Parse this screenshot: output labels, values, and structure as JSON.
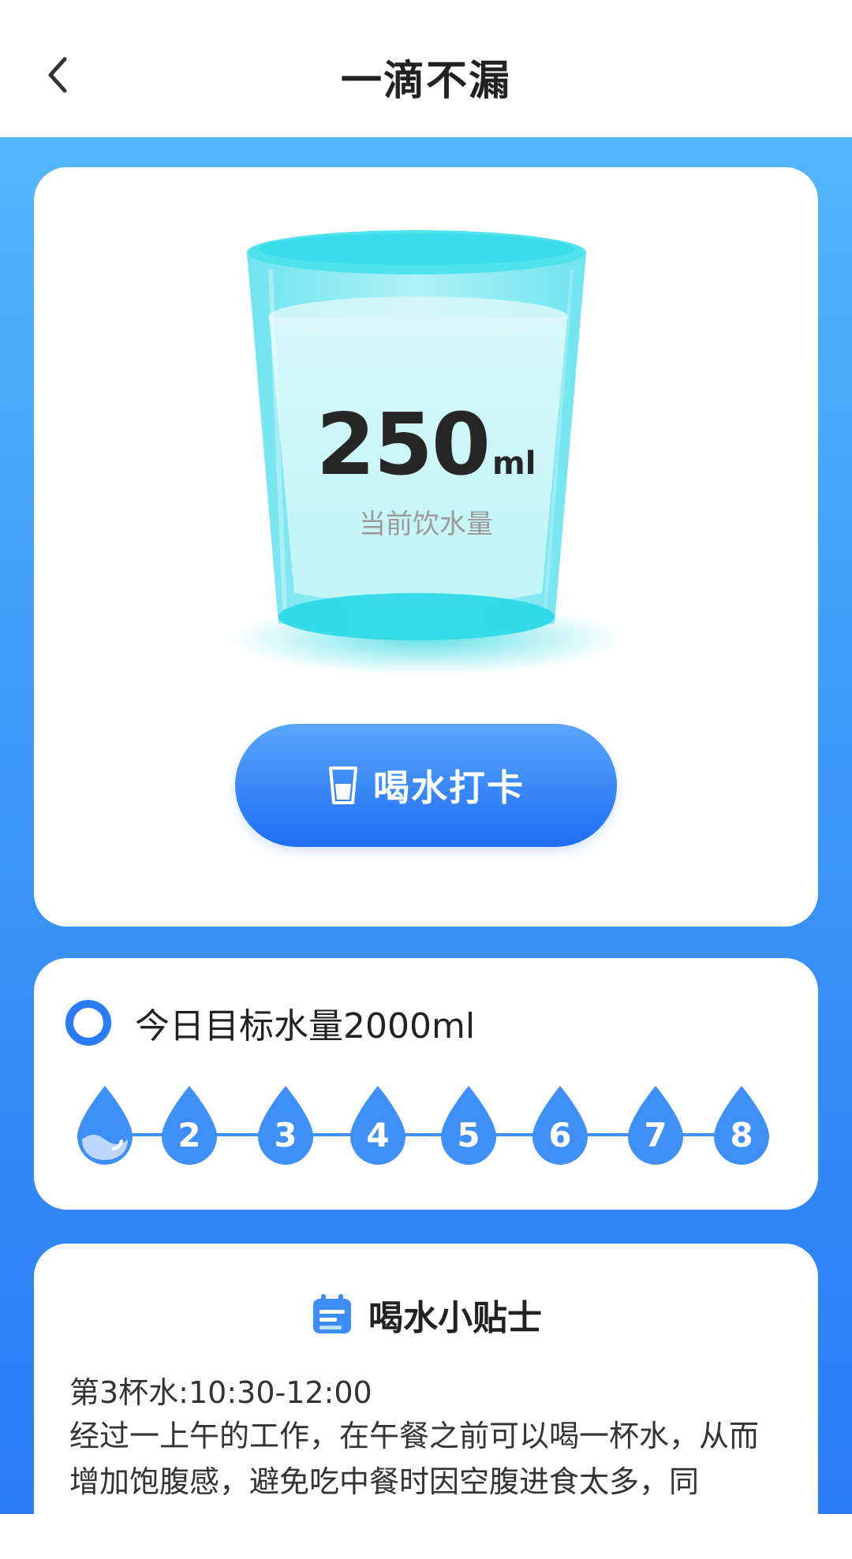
{
  "header": {
    "title": "一滴不漏"
  },
  "cup": {
    "value": "250",
    "unit": "ml",
    "label": "当前饮水量"
  },
  "checkin": {
    "label": "喝水打卡"
  },
  "goal": {
    "title": "今日目标水量2000ml",
    "completed": 1,
    "drops": [
      "1",
      "2",
      "3",
      "4",
      "5",
      "6",
      "7",
      "8"
    ]
  },
  "tips": {
    "title": "喝水小贴士",
    "time": "第3杯水:10:30-12:00",
    "body": "经过一上午的工作，在午餐之前可以喝一杯水，从而增加饱腹感，避免吃中餐时因空腹进食太多，同"
  },
  "colors": {
    "primary": "#2a7bf5",
    "drop": "#3f8ff8",
    "cup": "#67e3ef"
  }
}
